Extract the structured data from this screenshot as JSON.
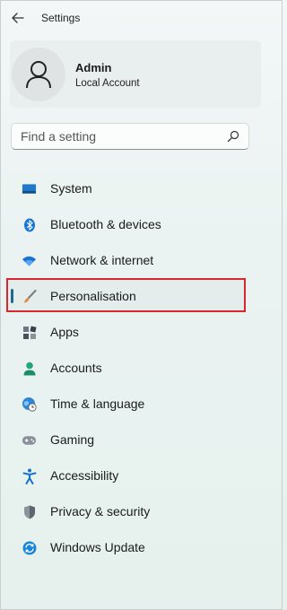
{
  "window": {
    "title": "Settings"
  },
  "profile": {
    "name": "Admin",
    "account_type": "Local Account"
  },
  "search": {
    "placeholder": "Find a setting"
  },
  "nav": {
    "items": [
      {
        "label": "System",
        "icon": "system-icon"
      },
      {
        "label": "Bluetooth & devices",
        "icon": "bluetooth-icon"
      },
      {
        "label": "Network & internet",
        "icon": "wifi-icon"
      },
      {
        "label": "Personalisation",
        "icon": "brush-icon",
        "selected": true
      },
      {
        "label": "Apps",
        "icon": "apps-icon"
      },
      {
        "label": "Accounts",
        "icon": "accounts-icon"
      },
      {
        "label": "Time & language",
        "icon": "globe-clock-icon"
      },
      {
        "label": "Gaming",
        "icon": "gamepad-icon"
      },
      {
        "label": "Accessibility",
        "icon": "accessibility-icon"
      },
      {
        "label": "Privacy & security",
        "icon": "shield-icon"
      },
      {
        "label": "Windows Update",
        "icon": "update-icon"
      }
    ]
  },
  "colors": {
    "accent": "#1d6b8c",
    "highlight_border": "#d8272e",
    "selected_bg": "#e4edeb"
  }
}
